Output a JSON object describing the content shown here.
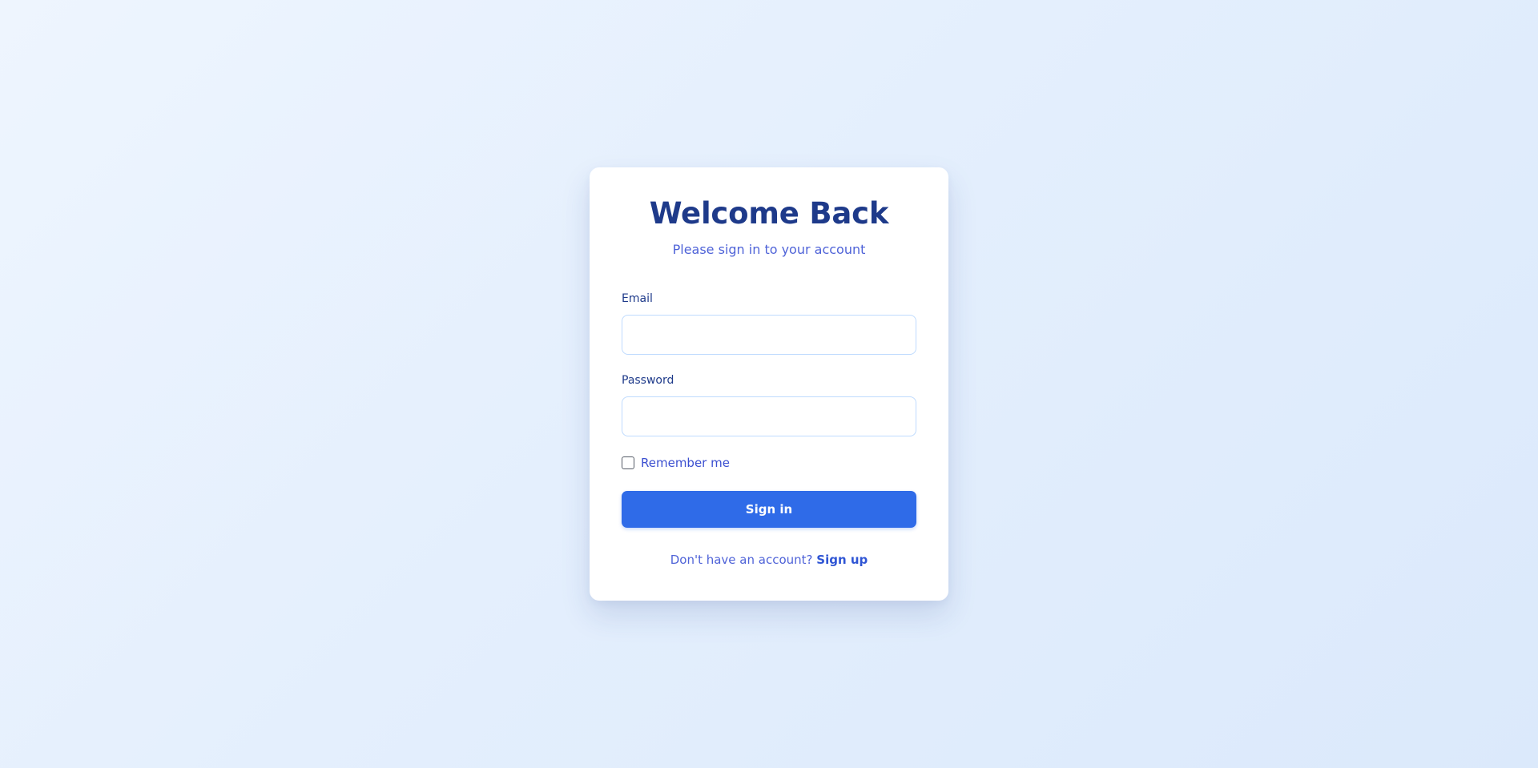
{
  "login": {
    "title": "Welcome Back",
    "subtitle": "Please sign in to your account",
    "email_label": "Email",
    "email_value": "",
    "password_label": "Password",
    "password_value": "",
    "remember_label": "Remember me",
    "remember_checked": false,
    "signin_label": "Sign in",
    "footer_text": "Don't have an account?",
    "signup_label": "Sign up"
  },
  "colors": {
    "primary": "#2f6be8",
    "heading": "#1e3a8a",
    "accent_text": "#4f63d8",
    "input_border": "#bfdbfe",
    "background": "#e6f0fd"
  }
}
